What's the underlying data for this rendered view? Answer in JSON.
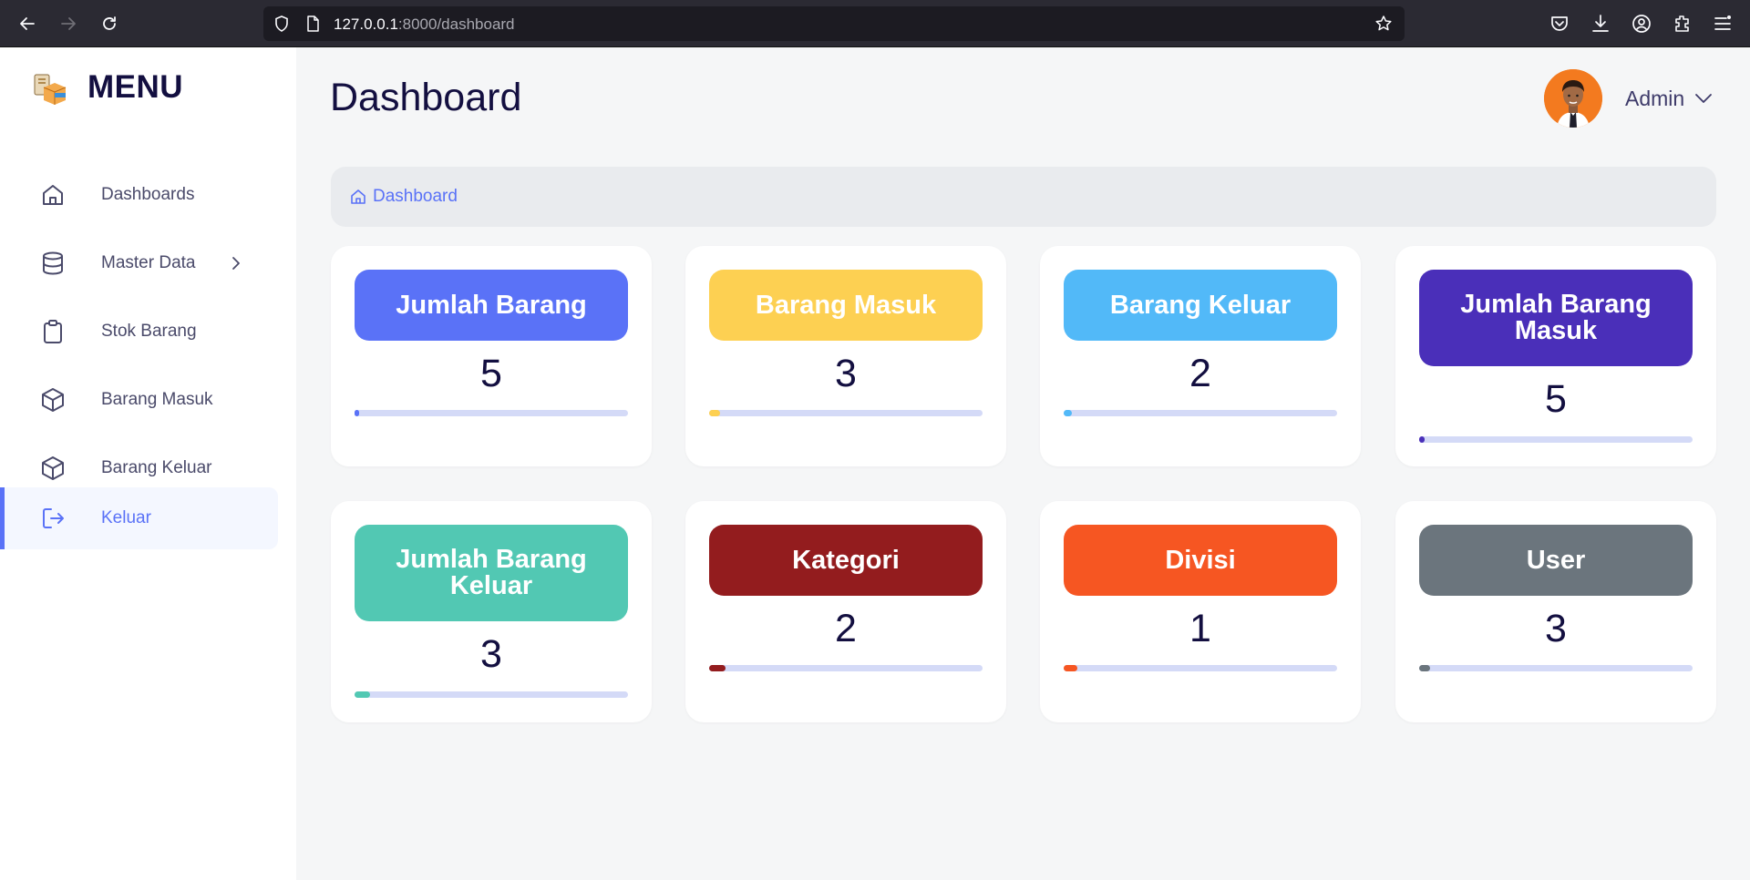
{
  "browser": {
    "url_host": "127.0.0.1",
    "url_rest": ":8000/dashboard"
  },
  "sidebar": {
    "title": "MENU",
    "items": [
      {
        "label": "Dashboards",
        "icon": "home-icon"
      },
      {
        "label": "Master Data",
        "icon": "database-icon"
      },
      {
        "label": "Stok Barang",
        "icon": "clipboard-icon"
      },
      {
        "label": "Barang Masuk",
        "icon": "box-icon"
      },
      {
        "label": "Barang Keluar",
        "icon": "box-icon"
      },
      {
        "label": "Keluar",
        "icon": "logout-icon",
        "active": true
      }
    ]
  },
  "header": {
    "title": "Dashboard",
    "user_name": "Admin"
  },
  "breadcrumb": {
    "label": "Dashboard"
  },
  "cards": [
    {
      "label": "Jumlah Barang",
      "value": "5",
      "color": "#5a72f7",
      "progress": 0.015
    },
    {
      "label": "Barang Masuk",
      "value": "3",
      "color": "#fdd052",
      "progress": 0.04
    },
    {
      "label": "Barang Keluar",
      "value": "2",
      "color": "#52b9f8",
      "progress": 0.03
    },
    {
      "label": "Jumlah Barang Masuk",
      "value": "5",
      "color": "#4a2fb9",
      "progress": 0.02
    },
    {
      "label": "Jumlah Barang Keluar",
      "value": "3",
      "color": "#52c8b3",
      "progress": 0.055
    },
    {
      "label": "Kategori",
      "value": "2",
      "color": "#931c1e",
      "progress": 0.06
    },
    {
      "label": "Divisi",
      "value": "1",
      "color": "#f65622",
      "progress": 0.05
    },
    {
      "label": "User",
      "value": "3",
      "color": "#6b757d",
      "progress": 0.04
    }
  ]
}
